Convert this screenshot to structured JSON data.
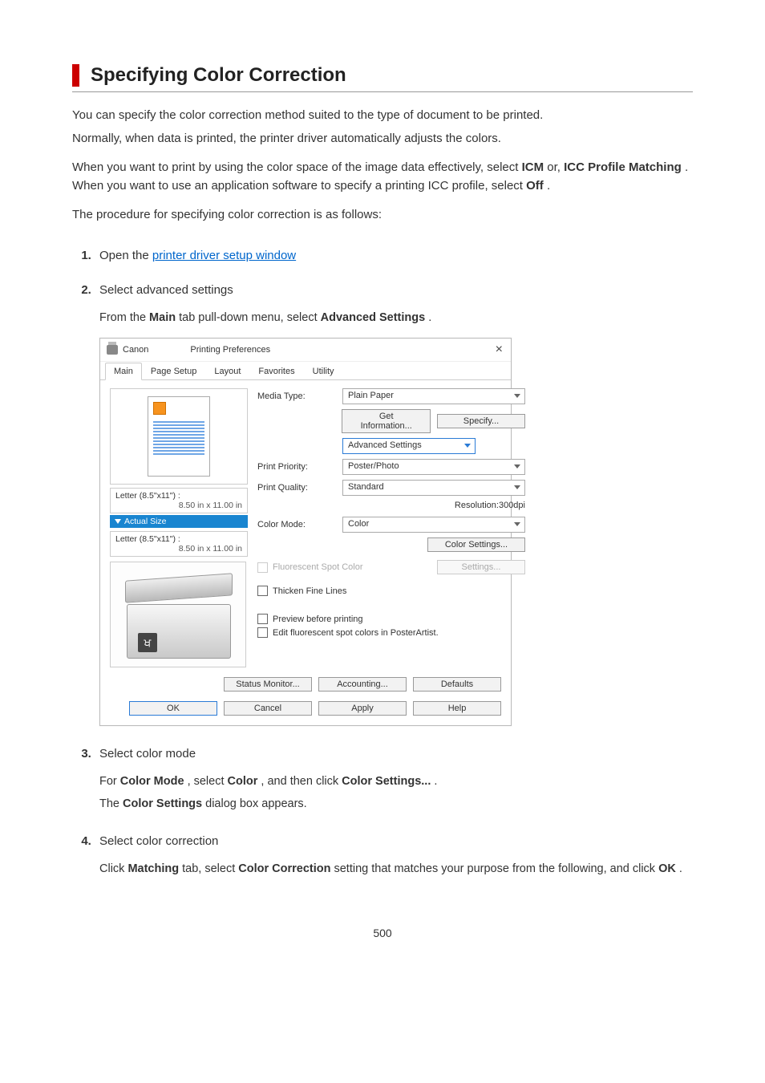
{
  "title": "Specifying Color Correction",
  "intro": {
    "p1": "You can specify the color correction method suited to the type of document to be printed.",
    "p2": "Normally, when data is printed, the printer driver automatically adjusts the colors.",
    "p3a": "When you want to print by using the color space of the image data effectively, select ",
    "p3_icm": "ICM",
    "p3b": " or, ",
    "p3_icc": "ICC Profile Matching",
    "p3c": ". When you want to use an application software to specify a printing ICC profile, select ",
    "p3_off": "Off",
    "p3d": ".",
    "p4": "The procedure for specifying color correction is as follows:"
  },
  "steps": {
    "s1_a": "Open the ",
    "s1_link": "printer driver setup window",
    "s2_title": "Select advanced settings",
    "s2_a": "From the ",
    "s2_main": "Main",
    "s2_b": " tab pull-down menu, select ",
    "s2_adv": "Advanced Settings",
    "s2_c": ".",
    "s3_title": "Select color mode",
    "s3_a": "For ",
    "s3_cm": "Color Mode",
    "s3_b": ", select ",
    "s3_color": "Color",
    "s3_c": ", and then click ",
    "s3_cs": "Color Settings...",
    "s3_d": ".",
    "s3_e": "The ",
    "s3_csdlg": "Color Settings",
    "s3_f": " dialog box appears.",
    "s4_title": "Select color correction",
    "s4_a": "Click ",
    "s4_match": "Matching",
    "s4_b": " tab, select ",
    "s4_cc": "Color Correction",
    "s4_c": " setting that matches your purpose from the following, and click ",
    "s4_ok": "OK",
    "s4_d": "."
  },
  "dialog": {
    "title_brand": "Canon",
    "title_suffix": "Printing Preferences",
    "tabs": [
      "Main",
      "Page Setup",
      "Layout",
      "Favorites",
      "Utility"
    ],
    "left": {
      "size1_label": "Letter (8.5\"x11\") :",
      "size1_dim": "8.50 in x 11.00 in",
      "actual_size": "Actual Size",
      "size2_label": "Letter (8.5\"x11\") :",
      "size2_dim": "8.50 in x 11.00 in"
    },
    "right": {
      "media_type_lbl": "Media Type:",
      "media_type_val": "Plain Paper",
      "get_info_btn": "Get Information...",
      "specify_btn": "Specify...",
      "mode_dd": "Advanced Settings",
      "print_priority_lbl": "Print Priority:",
      "print_priority_val": "Poster/Photo",
      "print_quality_lbl": "Print Quality:",
      "print_quality_val": "Standard",
      "resolution": "Resolution:300dpi",
      "color_mode_lbl": "Color Mode:",
      "color_mode_val": "Color",
      "color_settings_btn": "Color Settings...",
      "fluorescent_chk": "Fluorescent Spot Color",
      "settings_btn": "Settings...",
      "thicken_chk": "Thicken Fine Lines",
      "preview_chk": "Preview before printing",
      "edit_fluorescent_chk": "Edit fluorescent spot colors in PosterArtist.",
      "status_monitor_btn": "Status Monitor...",
      "accounting_btn": "Accounting...",
      "defaults_btn": "Defaults"
    },
    "footer": {
      "ok": "OK",
      "cancel": "Cancel",
      "apply": "Apply",
      "help": "Help"
    }
  },
  "page_number": "500"
}
